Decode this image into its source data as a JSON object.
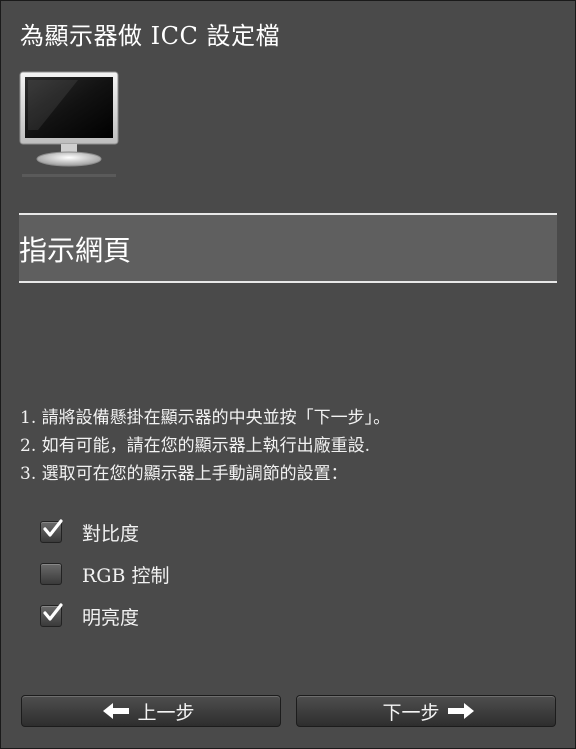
{
  "window": {
    "title": "為顯示器做 ICC 設定檔"
  },
  "section": {
    "title": "指示網頁"
  },
  "instructions": [
    "1.  請將設備懸掛在顯示器的中央並按「下一步」。",
    "2. 如有可能，請在您的顯示器上執行出廠重設.",
    "3. 選取可在您的顯示器上手動調節的設置："
  ],
  "options": [
    {
      "label": "對比度",
      "checked": true
    },
    {
      "label": "RGB 控制",
      "checked": false
    },
    {
      "label": "明亮度",
      "checked": true
    }
  ],
  "buttons": {
    "back": "上一步",
    "next": "下一步"
  },
  "icons": {
    "monitor": "monitor-icon",
    "back": "arrow-left-icon",
    "next": "arrow-right-icon",
    "check": "checkmark-icon"
  }
}
